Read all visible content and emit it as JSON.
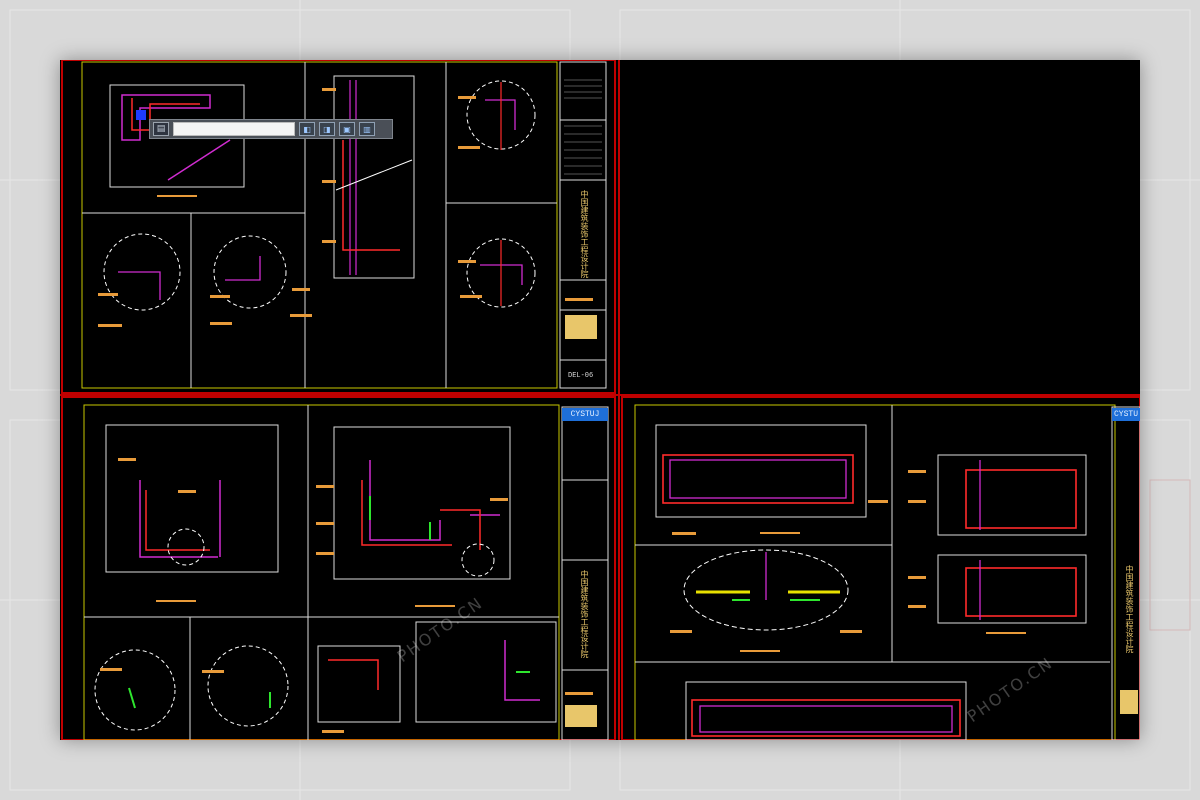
{
  "toolbar": {
    "input_value": "",
    "icons": [
      "layer-icon",
      "zoom-in-icon",
      "zoom-out-icon",
      "pan-icon",
      "window-icon"
    ]
  },
  "sheets": [
    {
      "code": "DEL-06",
      "badge": "",
      "title_vertical": "中国建筑装饰工程设计院"
    },
    {
      "code": "",
      "badge": "CYSTUJ",
      "title_vertical": "中国建筑装饰工程设计院"
    },
    {
      "code": "",
      "badge": "CYSTU",
      "title_vertical": "中国建筑装饰工程设计院"
    }
  ],
  "watermarks": [
    "PHOTO.CN",
    "PHOTO.CN"
  ],
  "colors": {
    "background": "#d9d9d9",
    "canvas": "#000000",
    "frame_red": "#c00000",
    "line_white": "#ffffff",
    "line_magenta": "#d02cd0",
    "line_red": "#ff2a2a",
    "line_yellow": "#e8e000",
    "line_green": "#2ee62e",
    "line_orange": "#e89b3a",
    "badge_blue": "#1e6fd9"
  }
}
